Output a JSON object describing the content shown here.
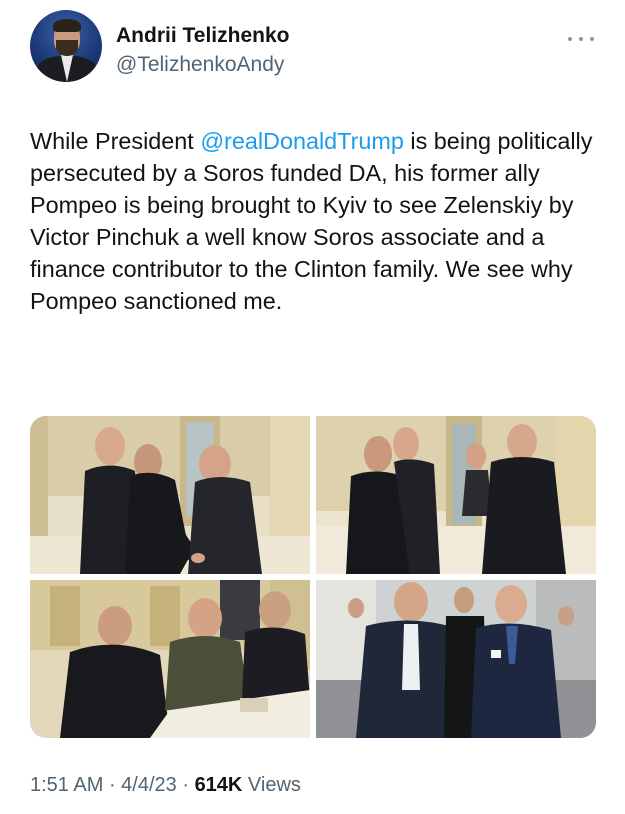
{
  "author": {
    "display_name": "Andrii Telizhenko",
    "handle": "@TelizhenkoAndy"
  },
  "tweet": {
    "text_before_mention": "While President ",
    "mention": "@realDonaldTrump",
    "text_after_mention": " is being politically persecuted by a Soros funded DA, his former ally Pompeo is being brought to Kyiv to see Zelenskiy by Victor Pinchuk a well know Soros associate and a finance contributor to the Clinton family. We see why Pompeo sanctioned me."
  },
  "meta": {
    "time": "1:51 AM",
    "separator": " · ",
    "date": "4/4/23",
    "views_count": "614K",
    "views_label": " Views"
  },
  "colors": {
    "mention": "#1d9bf0",
    "secondary_text": "#536471",
    "primary_text": "#0f1419"
  },
  "icons": {
    "more": "more-horizontal-icon"
  }
}
